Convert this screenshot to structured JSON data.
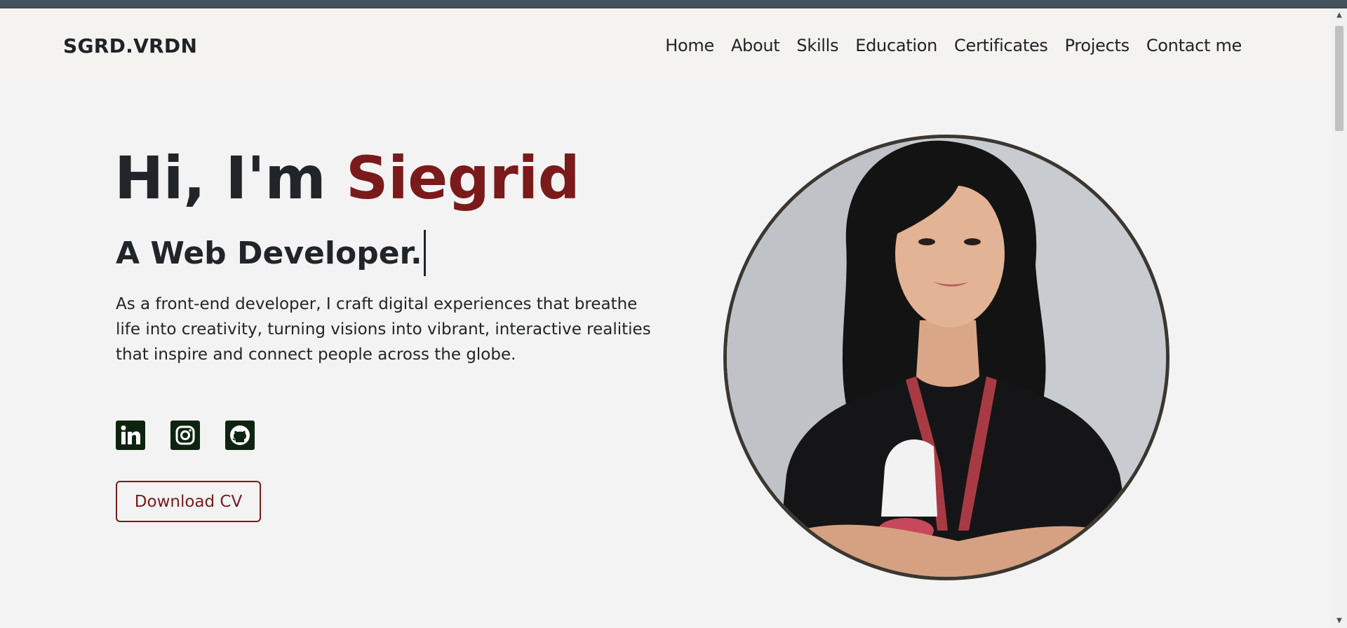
{
  "navbar": {
    "brand": "SGRD.VRDN",
    "links": [
      "Home",
      "About",
      "Skills",
      "Education",
      "Certificates",
      "Projects",
      "Contact me"
    ]
  },
  "hero": {
    "greeting": "Hi, I'm",
    "name": "Siegrid",
    "subtitle": "A Web Developer.",
    "description": "As a front-end developer, I craft digital experiences that breathe life into creativity, turning visions into vibrant, interactive realities that inspire and connect people across the globe.",
    "cv_button": "Download CV"
  },
  "socials": [
    {
      "icon": "linkedin-icon"
    },
    {
      "icon": "instagram-icon"
    },
    {
      "icon": "github-icon"
    }
  ],
  "colors": {
    "accent": "#7b1a1a",
    "text": "#212529",
    "social_bg": "#0e2410",
    "photo_border": "#3b3730"
  }
}
